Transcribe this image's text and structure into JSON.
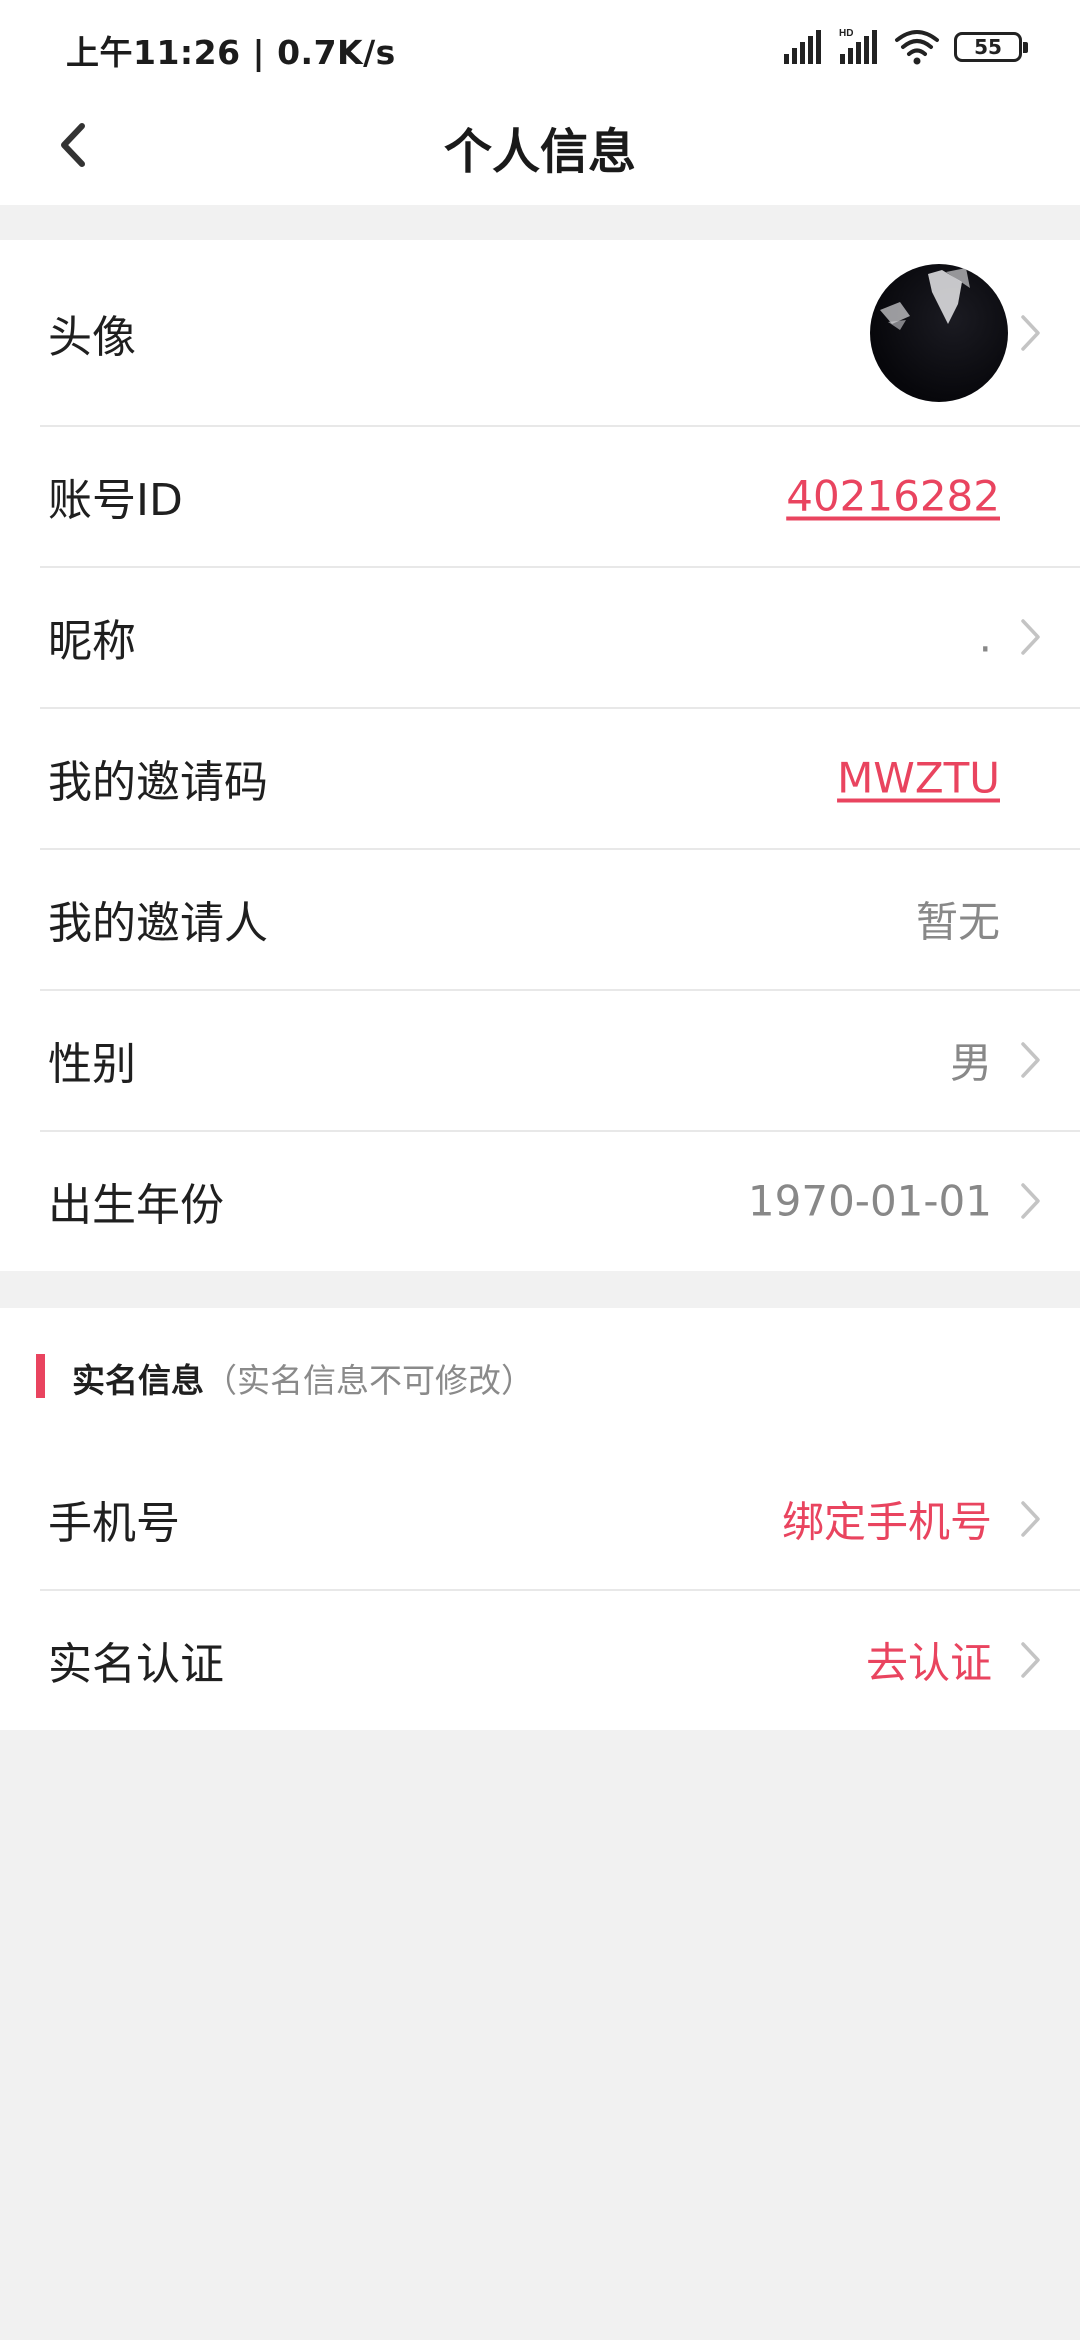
{
  "status_bar": {
    "time_speed": "上午11:26 | 0.7K/s",
    "battery": "55",
    "signal_icons": [
      "signal-icon",
      "hd-signal-icon",
      "wifi-icon",
      "battery-icon"
    ]
  },
  "nav": {
    "title": "个人信息",
    "back_icon": "chevron-left-icon"
  },
  "profile": {
    "avatar_label": "头像",
    "account_id_label": "账号ID",
    "account_id_value": "40216282",
    "nickname_label": "昵称",
    "nickname_value": ".",
    "invite_code_label": "我的邀请码",
    "invite_code_value": "MWZTU",
    "inviter_label": "我的邀请人",
    "inviter_value": "暂无",
    "gender_label": "性别",
    "gender_value": "男",
    "birth_year_label": "出生年份",
    "birth_year_value": "1970-01-01"
  },
  "real_name": {
    "header_title": "实名信息",
    "header_note": "（实名信息不可修改）",
    "phone_label": "手机号",
    "phone_value": "绑定手机号",
    "verify_label": "实名认证",
    "verify_value": "去认证"
  },
  "colors": {
    "accent": "#e9445f",
    "background": "#f1f1f1",
    "card": "#ffffff",
    "muted_text": "#888888"
  }
}
